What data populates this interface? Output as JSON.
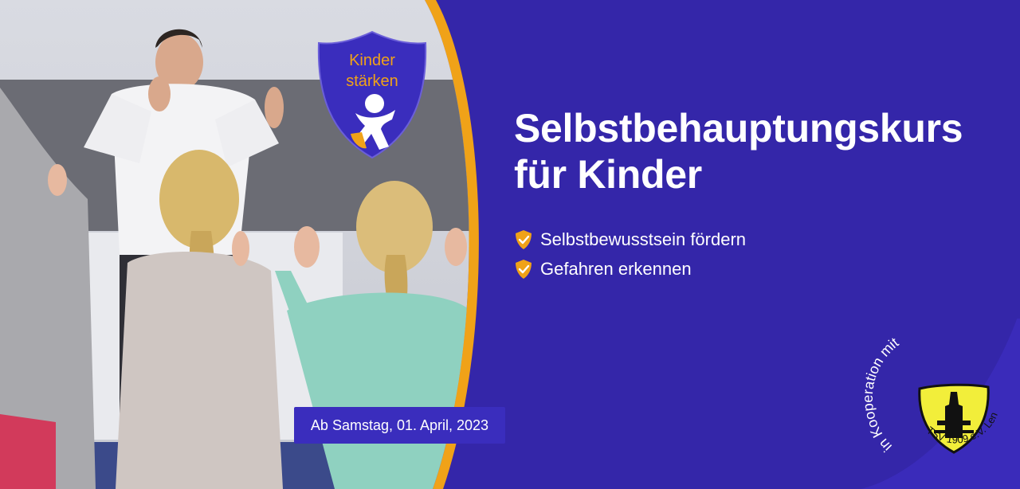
{
  "headline": {
    "line1": "Selbstbehauptungskurs",
    "line2": "für Kinder"
  },
  "bullets": [
    {
      "icon": "shield-check-icon",
      "label": "Selbstbewusstsein fördern"
    },
    {
      "icon": "shield-check-icon",
      "label": "Gefahren erkennen"
    }
  ],
  "date_badge": "Ab Samstag, 01. April, 2023",
  "kinder_logo": {
    "line1": "Kinder",
    "line2": "stärken"
  },
  "cooperation": {
    "arc_text": "in Kooperation mit",
    "club_text": "TSV 1909 e.V. Lengfeld"
  },
  "colors": {
    "background": "#3426a9",
    "accent_orange": "#f0a218",
    "badge": "#3a2dbd",
    "crest_yellow": "#f2ee3a"
  }
}
